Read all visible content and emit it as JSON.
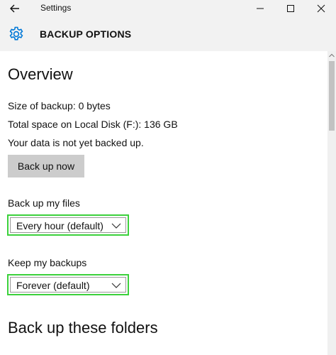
{
  "window": {
    "title": "Settings"
  },
  "header": {
    "icon": "gear-icon",
    "title": "BACKUP OPTIONS",
    "accent_color": "#0078d7"
  },
  "overview": {
    "heading": "Overview",
    "size_of_backup": "Size of backup: 0 bytes",
    "total_space": "Total space on Local Disk (F:): 136 GB",
    "status": "Your data is not yet backed up.",
    "backup_button_label": "Back up now"
  },
  "backup_frequency": {
    "label": "Back up my files",
    "selected": "Every hour (default)"
  },
  "retention": {
    "label": "Keep my backups",
    "selected": "Forever (default)"
  },
  "folders": {
    "heading": "Back up these folders"
  },
  "colors": {
    "highlight_border": "#3cd13c",
    "button_bg": "#cccccc",
    "titlebar_bg": "#f2f2f2"
  }
}
